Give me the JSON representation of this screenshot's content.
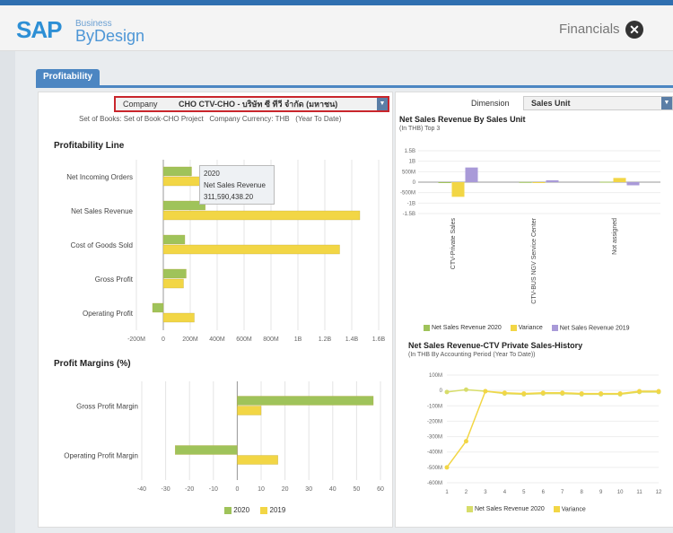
{
  "app": {
    "logo_sap": "SAP",
    "logo_business": "Business",
    "logo_bydesign": "ByDesign",
    "title": "Financials",
    "close_glyph": "✕"
  },
  "tabs": [
    {
      "label": "Profitability"
    }
  ],
  "left": {
    "company_label": "Company",
    "company_value": "CHO CTV-CHO - บริษัท ซี ทีวี จำกัด (มหาชน)",
    "info_line": "Set of Books: Set of Book-CHO Project   Company Currency: THB   (Year To Date)",
    "profit_title": "Profitability Line",
    "margins_title": "Profit Margins (%)",
    "tooltip": {
      "year": "2020",
      "measure": "Net Sales Revenue",
      "value": "311,590,438.20"
    },
    "legend": [
      {
        "label": "2020",
        "color": "#9fc35a"
      },
      {
        "label": "2019",
        "color": "#f2d645"
      }
    ]
  },
  "right": {
    "dimension_label": "Dimension",
    "dimension_value": "Sales Unit",
    "chart1_title": "Net Sales Revenue By Sales Unit",
    "chart1_sub": "(In THB) Top 3",
    "chart1_legend": [
      {
        "label": "Net Sales Revenue 2020",
        "color": "#9fc35a"
      },
      {
        "label": "Variance",
        "color": "#f2d645"
      },
      {
        "label": "Net Sales Revenue 2019",
        "color": "#a99ad8"
      }
    ],
    "chart2_title": "Net Sales Revenue-CTV Private Sales-History",
    "chart2_sub": "(In THB By Accounting Period (Year To Date))",
    "chart2_legend": [
      {
        "label": "Net Sales Revenue 2020",
        "color": "#d7dd6a"
      },
      {
        "label": "Variance",
        "color": "#f2d645"
      }
    ]
  },
  "chart_data": [
    {
      "type": "bar",
      "orientation": "horizontal",
      "title": "Profitability Line",
      "categories": [
        "Net Incoming Orders",
        "Net Sales Revenue",
        "Cost of Goods Sold",
        "Gross Profit",
        "Operating Profit"
      ],
      "series": [
        {
          "name": "2020",
          "color": "#9fc35a",
          "values": [
            210,
            311.59,
            160,
            170,
            -80
          ]
        },
        {
          "name": "2019",
          "color": "#f2d645",
          "values": [
            300,
            1460,
            1310,
            150,
            230
          ]
        }
      ],
      "xticks": [
        "-200M",
        "0",
        "200M",
        "400M",
        "600M",
        "800M",
        "1B",
        "1.2B",
        "1.4B",
        "1.6B"
      ],
      "xlim": [
        -200,
        1600
      ]
    },
    {
      "type": "bar",
      "orientation": "horizontal",
      "title": "Profit Margins (%)",
      "categories": [
        "Gross Profit Margin",
        "Operating Profit Margin"
      ],
      "series": [
        {
          "name": "2020",
          "color": "#9fc35a",
          "values": [
            57,
            -26
          ]
        },
        {
          "name": "2019",
          "color": "#f2d645",
          "values": [
            10,
            17
          ]
        }
      ],
      "xticks": [
        "-40",
        "-30",
        "-20",
        "-10",
        "0",
        "10",
        "20",
        "30",
        "40",
        "50",
        "60"
      ],
      "xlim": [
        -40,
        60
      ]
    },
    {
      "type": "bar",
      "title": "Net Sales Revenue By Sales Unit",
      "categories": [
        "CTV-Private Sales",
        "CTV-BUS NGV Service Center",
        "Not assigned"
      ],
      "series": [
        {
          "name": "Net Sales Revenue 2020",
          "color": "#9fc35a",
          "values": [
            -20,
            10,
            20
          ]
        },
        {
          "name": "Variance",
          "color": "#f2d645",
          "values": [
            -700,
            -20,
            200
          ]
        },
        {
          "name": "Net Sales Revenue 2019",
          "color": "#a99ad8",
          "values": [
            700,
            90,
            -150
          ]
        }
      ],
      "yticks": [
        "1.5B",
        "1B",
        "500M",
        "0",
        "-500M",
        "-1B",
        "-1.5B"
      ],
      "ylim": [
        -1500,
        1500
      ]
    },
    {
      "type": "line",
      "title": "Net Sales Revenue-CTV Private Sales-History",
      "x": [
        1,
        2,
        3,
        4,
        5,
        6,
        7,
        8,
        9,
        10,
        11,
        12
      ],
      "series": [
        {
          "name": "Net Sales Revenue 2020",
          "color": "#d7dd6a",
          "values": [
            -10,
            5,
            -5,
            -20,
            -25,
            -20,
            -20,
            -25,
            -25,
            -25,
            -10,
            -10
          ]
        },
        {
          "name": "Variance",
          "color": "#f2d645",
          "values": [
            -500,
            -330,
            -5,
            -15,
            -20,
            -15,
            -15,
            -20,
            -20,
            -20,
            -5,
            -5
          ]
        }
      ],
      "yticks": [
        "100M",
        "0",
        "-100M",
        "-200M",
        "-300M",
        "-400M",
        "-500M",
        "-600M"
      ],
      "ylim": [
        -600,
        100
      ]
    }
  ]
}
